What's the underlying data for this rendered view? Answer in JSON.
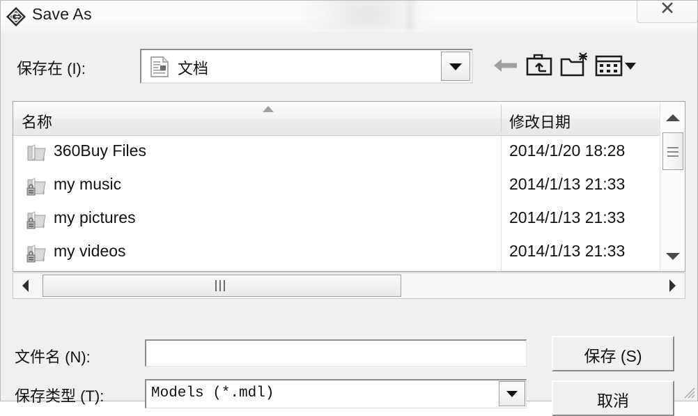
{
  "window": {
    "title": "Save As",
    "app_icon": "simulink-diamond-icon",
    "close_label": "✕"
  },
  "toolbar": {
    "save_in_label": "保存在 (I):",
    "location_value": "文档",
    "location_icon": "document-icon",
    "dropdown_icon": "chevron-down-icon",
    "buttons": [
      {
        "name": "back-button",
        "icon": "back-arrow-icon"
      },
      {
        "name": "up-one-level-button",
        "icon": "folder-up-icon"
      },
      {
        "name": "new-folder-button",
        "icon": "new-folder-icon"
      },
      {
        "name": "views-button",
        "icon": "views-grid-icon"
      }
    ]
  },
  "file_list": {
    "columns": [
      "名称",
      "修改日期"
    ],
    "sort_column": "名称",
    "sort_direction": "ascending",
    "rows": [
      {
        "name": "360Buy Files",
        "date": "2014/1/20 18:28",
        "icon": "folder-icon"
      },
      {
        "name": "my music",
        "date": "2014/1/13 21:33",
        "icon": "folder-locked-icon"
      },
      {
        "name": "my pictures",
        "date": "2014/1/13 21:33",
        "icon": "folder-locked-icon"
      },
      {
        "name": "my videos",
        "date": "2014/1/13 21:33",
        "icon": "folder-locked-icon"
      }
    ]
  },
  "fields": {
    "file_name_label": "文件名 (N):",
    "file_name_value": "",
    "file_type_label": "保存类型 (T):",
    "file_type_value": "Models  (*.mdl)"
  },
  "actions": {
    "save_label": "保存 (S)",
    "cancel_label": "取消"
  },
  "colors": {
    "dialog_bg": "#f0f0f0",
    "list_bg": "#ffffff",
    "text": "#111111",
    "border": "#a3a3a3"
  }
}
